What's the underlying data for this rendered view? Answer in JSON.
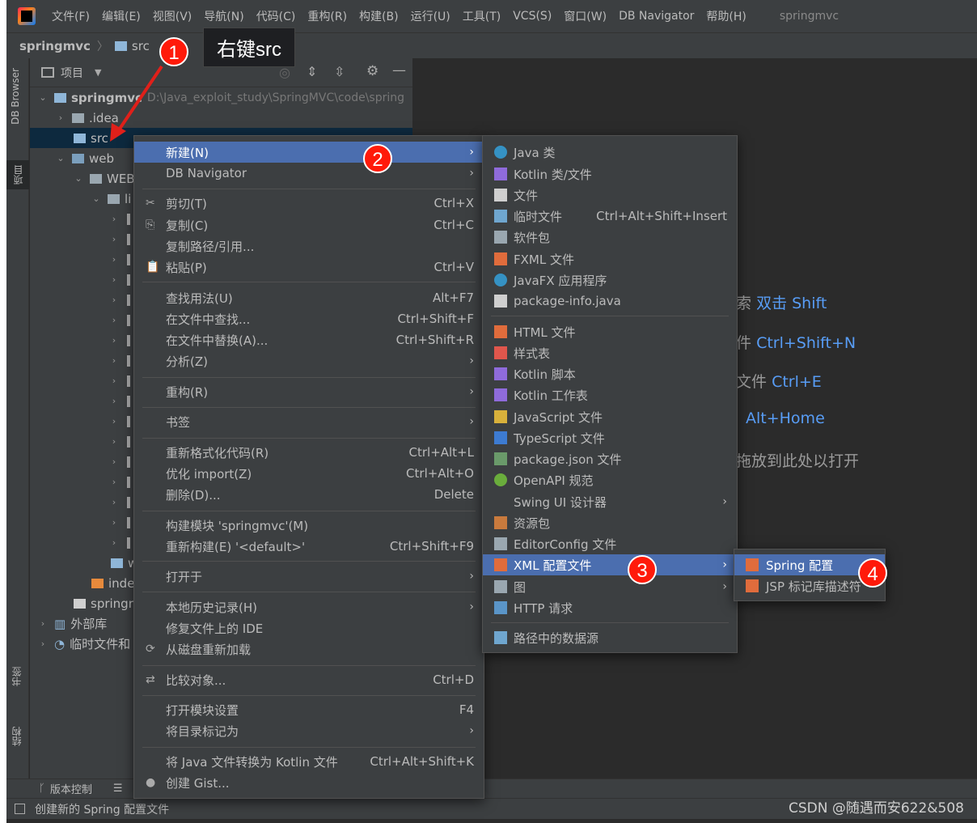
{
  "menubar": {
    "items": [
      "文件(F)",
      "编辑(E)",
      "视图(V)",
      "导航(N)",
      "代码(C)",
      "重构(R)",
      "构建(B)",
      "运行(U)",
      "工具(T)",
      "VCS(S)",
      "窗口(W)",
      "DB Navigator",
      "帮助(H)"
    ],
    "project": "springmvc"
  },
  "breadcrumb": {
    "project": "springmvc",
    "folder": "src"
  },
  "left_tabs": {
    "db_browser": "DB Browser",
    "project": "项目",
    "bookmarks": "书签",
    "structure": "结构"
  },
  "project_panel": {
    "title": "项目",
    "root_name": "springmvc",
    "root_path": "D:\\Java_exploit_study\\SpringMVC\\code\\spring",
    "idea": ".idea",
    "src": "src",
    "web": "web",
    "webinf": "WEB",
    "lib": "li",
    "w_file": "w",
    "index": "inde",
    "springr": "springr",
    "external": "外部库",
    "scratch": "临时文件和"
  },
  "editor_hints": [
    {
      "text": "索",
      "key": "双击 Shift"
    },
    {
      "text": "件",
      "key": "Ctrl+Shift+N"
    },
    {
      "text": "文件",
      "key": "Ctrl+E"
    },
    {
      "text": "",
      "key": "Alt+Home"
    },
    {
      "text": "拖放到此处以打开",
      "key": ""
    }
  ],
  "context_menu": [
    {
      "label": "新建(N)",
      "shortcut": "",
      "sub": true,
      "hl": true
    },
    {
      "label": "DB Navigator",
      "shortcut": "",
      "sub": true
    },
    {
      "label": "剪切(T)",
      "shortcut": "Ctrl+X"
    },
    {
      "label": "复制(C)",
      "shortcut": "Ctrl+C"
    },
    {
      "label": "复制路径/引用...",
      "shortcut": ""
    },
    {
      "label": "粘贴(P)",
      "shortcut": "Ctrl+V"
    },
    {
      "label": "查找用法(U)",
      "shortcut": "Alt+F7"
    },
    {
      "label": "在文件中查找...",
      "shortcut": "Ctrl+Shift+F"
    },
    {
      "label": "在文件中替换(A)...",
      "shortcut": "Ctrl+Shift+R"
    },
    {
      "label": "分析(Z)",
      "shortcut": "",
      "sub": true
    },
    {
      "label": "重构(R)",
      "shortcut": "",
      "sub": true
    },
    {
      "label": "书签",
      "shortcut": "",
      "sub": true
    },
    {
      "label": "重新格式化代码(R)",
      "shortcut": "Ctrl+Alt+L"
    },
    {
      "label": "优化 import(Z)",
      "shortcut": "Ctrl+Alt+O"
    },
    {
      "label": "删除(D)...",
      "shortcut": "Delete"
    },
    {
      "label": "构建模块 'springmvc'(M)",
      "shortcut": ""
    },
    {
      "label": "重新构建(E) '<default>'",
      "shortcut": "Ctrl+Shift+F9"
    },
    {
      "label": "打开于",
      "shortcut": "",
      "sub": true
    },
    {
      "label": "本地历史记录(H)",
      "shortcut": "",
      "sub": true
    },
    {
      "label": "修复文件上的 IDE",
      "shortcut": ""
    },
    {
      "label": "从磁盘重新加载",
      "shortcut": ""
    },
    {
      "label": "比较对象...",
      "shortcut": "Ctrl+D"
    },
    {
      "label": "打开模块设置",
      "shortcut": "F4"
    },
    {
      "label": "将目录标记为",
      "shortcut": "",
      "sub": true
    },
    {
      "label": "将 Java 文件转换为 Kotlin 文件",
      "shortcut": "Ctrl+Alt+Shift+K"
    },
    {
      "label": "创建 Gist...",
      "shortcut": ""
    }
  ],
  "new_menu": [
    {
      "label": "Java 类",
      "icon": "java-class-icon"
    },
    {
      "label": "Kotlin 类/文件",
      "icon": "kotlin-file-icon"
    },
    {
      "label": "文件",
      "icon": "file-icon"
    },
    {
      "label": "临时文件",
      "icon": "scratch-file-icon",
      "shortcut": "Ctrl+Alt+Shift+Insert"
    },
    {
      "label": "软件包",
      "icon": "package-icon"
    },
    {
      "label": "FXML 文件",
      "icon": "fxml-file-icon"
    },
    {
      "label": "JavaFX 应用程序",
      "icon": "javafx-app-icon"
    },
    {
      "label": "package-info.java",
      "icon": "package-info-icon"
    },
    {
      "label": "HTML 文件",
      "icon": "html-file-icon"
    },
    {
      "label": "样式表",
      "icon": "css-file-icon"
    },
    {
      "label": "Kotlin 脚本",
      "icon": "kotlin-script-icon"
    },
    {
      "label": "Kotlin 工作表",
      "icon": "kotlin-worksheet-icon"
    },
    {
      "label": "JavaScript 文件",
      "icon": "js-file-icon"
    },
    {
      "label": "TypeScript 文件",
      "icon": "ts-file-icon"
    },
    {
      "label": "package.json 文件",
      "icon": "package-json-icon"
    },
    {
      "label": "OpenAPI 规范",
      "icon": "openapi-icon"
    },
    {
      "label": "Swing UI 设计器",
      "icon": "",
      "sub": true
    },
    {
      "label": "资源包",
      "icon": "resource-bundle-icon"
    },
    {
      "label": "EditorConfig 文件",
      "icon": "editorconfig-icon"
    },
    {
      "label": "XML 配置文件",
      "icon": "xml-config-icon",
      "sub": true,
      "hl": true
    },
    {
      "label": "图",
      "icon": "diagram-icon",
      "sub": true
    },
    {
      "label": "HTTP 请求",
      "icon": "http-request-icon"
    },
    {
      "label": "路径中的数据源",
      "icon": "datasource-icon"
    }
  ],
  "xml_menu": [
    {
      "label": "Spring 配置",
      "hl": true
    },
    {
      "label": "JSP 标记库描述符"
    }
  ],
  "callouts": {
    "step1": "1",
    "step2": "2",
    "step3": "3",
    "step4": "4",
    "tooltip": "右键src"
  },
  "bottom": {
    "vcs": "版本控制",
    "status": "创建新的 Spring 配置文件"
  },
  "watermark": "CSDN @随遇而安622&508",
  "colors": {
    "highlight": "#4b6eaf",
    "badge": "#ff1a0a",
    "link": "#589df6"
  }
}
